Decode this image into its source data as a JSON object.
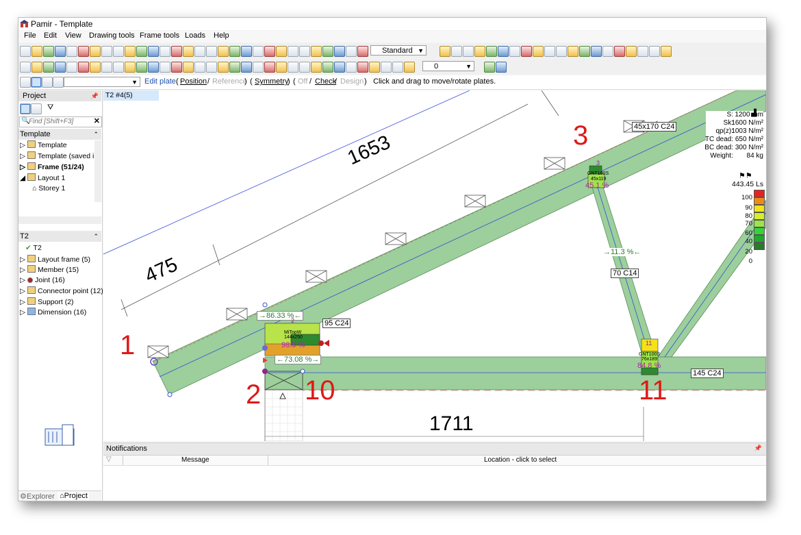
{
  "window": {
    "title": "Pamir - Template"
  },
  "menu": {
    "items": [
      "File",
      "Edit",
      "View",
      "Drawing tools",
      "Frame tools",
      "Loads",
      "Help"
    ]
  },
  "toolbar": {
    "style_combo": "Standard",
    "layer_combo": "0"
  },
  "edit_plate_bar": {
    "mode": "Edit plate",
    "open1": "(",
    "position": "Position",
    "sep1": "/",
    "reference": "Reference",
    "close1": ")",
    "open2": "(",
    "symmetry": "Symmetry",
    "close2": ")",
    "open3": "(",
    "off": "Off",
    "sep2": "/",
    "check": "Check",
    "sep3": "/",
    "design": "Design",
    "close3": ")",
    "hint": "Click and drag to move/rotate plates."
  },
  "project_panel": {
    "header": "Project",
    "find_placeholder": "Find [Shift+F3]",
    "template_header": "Template",
    "items": [
      "Template",
      "Template (saved in",
      "Frame (51/24)",
      "Layout 1",
      "Storey 1"
    ]
  },
  "t2_panel": {
    "header": "T2",
    "items": [
      "T2",
      "Layout frame (5)",
      "Member (15)",
      "Joint (16)",
      "Connector point (12)",
      "Support (2)",
      "Dimension (16)"
    ]
  },
  "bottom_tabs": {
    "explorer": "Explorer",
    "project": "Project"
  },
  "canvas": {
    "tab": "T2 #4(5)",
    "dims": {
      "d1653": "1653",
      "d475": "475",
      "d1711": "1711"
    },
    "node_labels": {
      "n1": "1",
      "n2": "2",
      "n3": "3",
      "n10": "10",
      "n11": "11"
    },
    "members": {
      "top_chord": "45x170 C24",
      "bottom_chord": "145 C24",
      "web": "70 C14",
      "heel": "95 C24"
    },
    "plates": {
      "p3_id": "3",
      "p3_type": "GNT100S",
      "p3_size": "45x119",
      "p3_util": "45.1 %",
      "p2_id": "2",
      "p2_type": "MiTopW",
      "p2_size": "144x250",
      "p2_util": "98.9 %",
      "p11_id": "11",
      "p11_type": "GNT100S",
      "p11_size": "76x189",
      "p11_util": "84.8 %"
    },
    "ratios": {
      "heel_top": "→86.33 %←",
      "heel_bottom": "←73.08 %→",
      "web": "→11.3 %←"
    },
    "info": [
      {
        "k": "S:",
        "v": "1200 mm"
      },
      {
        "k": "Sk:",
        "v": "1600 N/m²"
      },
      {
        "k": "qp(z):",
        "v": "1003 N/m²"
      },
      {
        "k": "TC dead:",
        "v": "650 N/m²"
      },
      {
        "k": "BC dead:",
        "v": "300 N/m²"
      },
      {
        "k": "Weight:",
        "v": "84 kg"
      }
    ],
    "ls": "443.45 Ls",
    "legend": {
      "labels": [
        "100",
        "90",
        "80",
        "70",
        "60",
        "40",
        "20",
        "0"
      ],
      "colors": [
        "#e82020",
        "#f08a14",
        "#f4e21a",
        "#d6ef2a",
        "#9ee34a",
        "#36d436",
        "#1faa2c",
        "#2b7a2b"
      ]
    }
  },
  "notifications": {
    "header": "Notifications",
    "col_message": "Message",
    "col_location": "Location - click to select"
  }
}
